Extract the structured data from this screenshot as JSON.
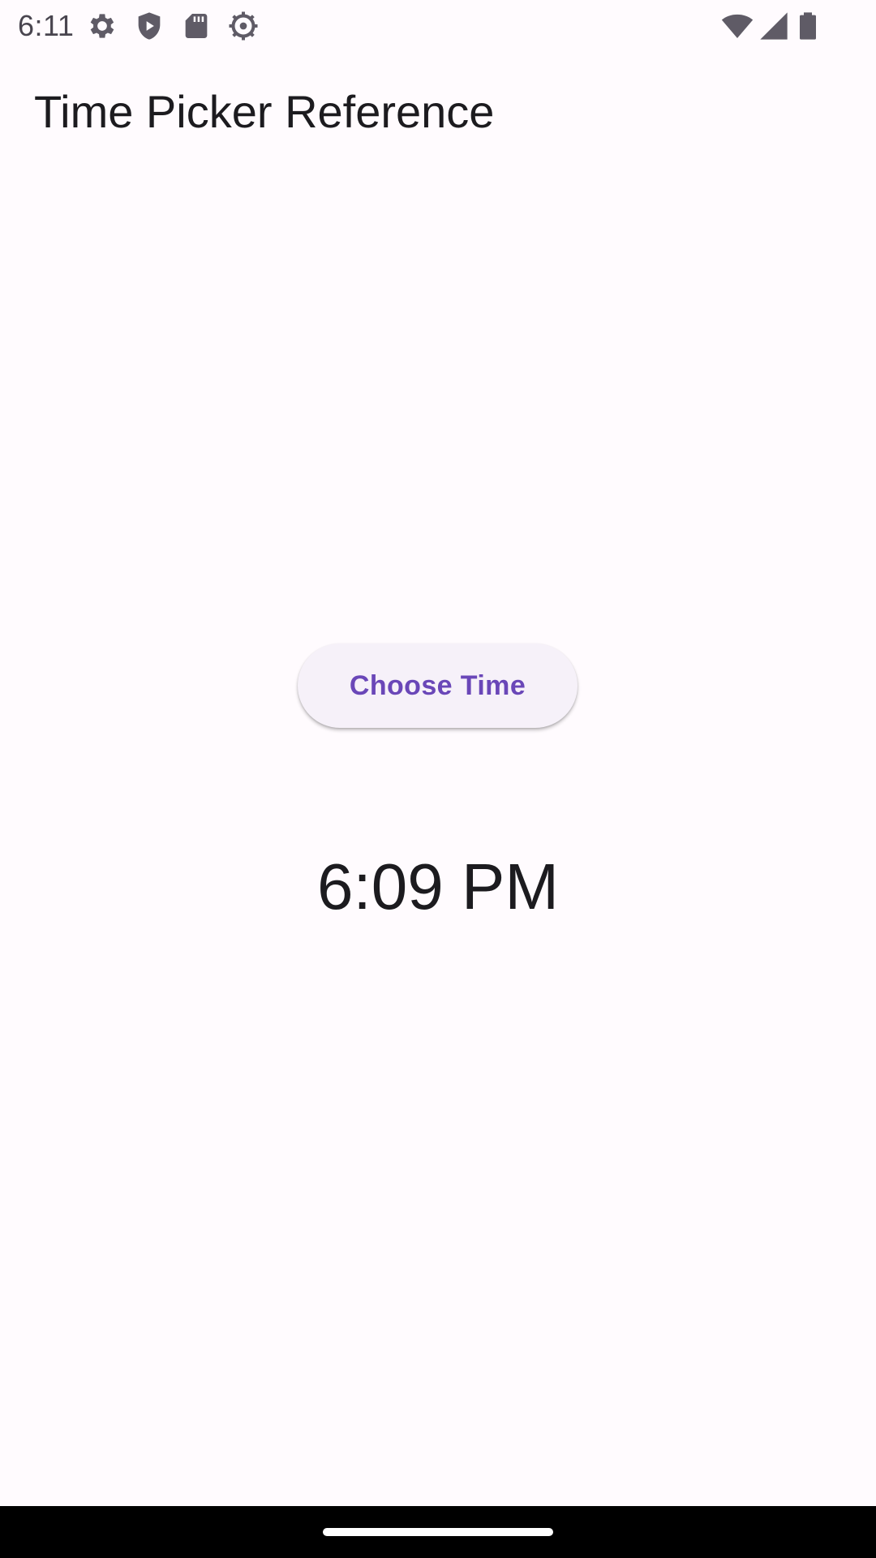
{
  "status_bar": {
    "time": "6:11",
    "icons": [
      "gear-icon",
      "shield-play-icon",
      "sd-card-icon",
      "settings-cog-icon",
      "wifi-icon",
      "cell-signal-icon",
      "battery-icon"
    ]
  },
  "app_bar": {
    "title": "Time Picker Reference"
  },
  "main": {
    "button_label": "Choose Time",
    "selected_time": "6:09 PM"
  },
  "colors": {
    "background": "#fffbfe",
    "button_background": "#f6f1f9",
    "button_text": "#6a47b8",
    "text_primary": "#1c1b1f",
    "nav_bar": "#000000"
  }
}
